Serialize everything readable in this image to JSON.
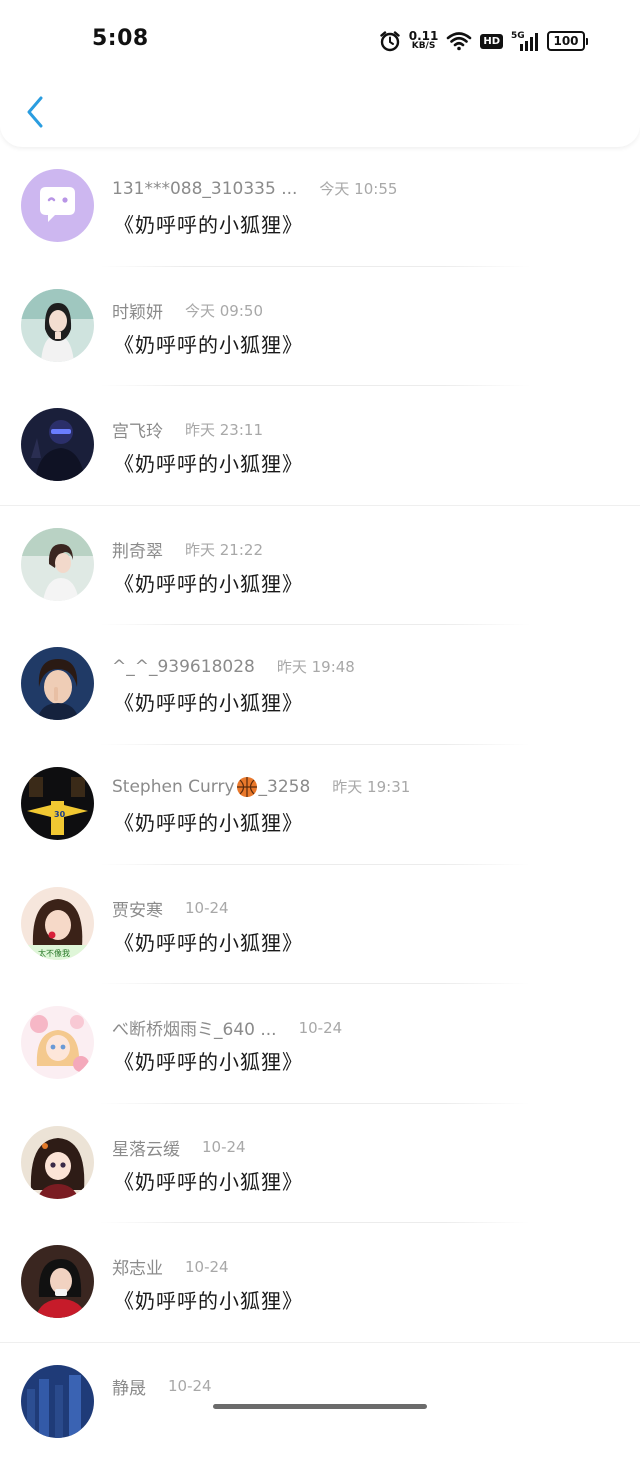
{
  "status_bar": {
    "time": "5:08",
    "net_speed": "0.11",
    "net_unit": "KB/S",
    "hd_label": "HD",
    "signal_label": "5G",
    "battery": "100"
  },
  "nav": {
    "back_icon": "chevron-left-icon",
    "accent_color": "#2a9de0"
  },
  "contacts": [
    {
      "name": "131***088_310335 ...",
      "time": "今天 10:55",
      "message": "《奶呼呼的小狐狸》"
    },
    {
      "name": "时颖妍",
      "time": "今天 09:50",
      "message": "《奶呼呼的小狐狸》"
    },
    {
      "name": "宫飞玲",
      "time": "昨天 23:11",
      "message": "《奶呼呼的小狐狸》"
    },
    {
      "name": "荆奇翠",
      "time": "昨天 21:22",
      "message": "《奶呼呼的小狐狸》"
    },
    {
      "name": "^_^_939618028",
      "time": "昨天 19:48",
      "message": "《奶呼呼的小狐狸》"
    },
    {
      "name_prefix": "Stephen Curry",
      "name_suffix": "_3258",
      "name_emoji": "basketball-icon",
      "time": "昨天 19:31",
      "message": "《奶呼呼的小狐狸》"
    },
    {
      "name": "贾安寒",
      "time": "10-24",
      "message": "《奶呼呼的小狐狸》",
      "avatar_caption": "太不像我"
    },
    {
      "name": "べ断桥烟雨ミ_640 ...",
      "time": "10-24",
      "message": "《奶呼呼的小狐狸》"
    },
    {
      "name": "星落云缓",
      "time": "10-24",
      "message": "《奶呼呼的小狐狸》"
    },
    {
      "name": "郑志业",
      "time": "10-24",
      "message": "《奶呼呼的小狐狸》"
    },
    {
      "name": "静晟",
      "time": "10-24",
      "message": ""
    }
  ]
}
